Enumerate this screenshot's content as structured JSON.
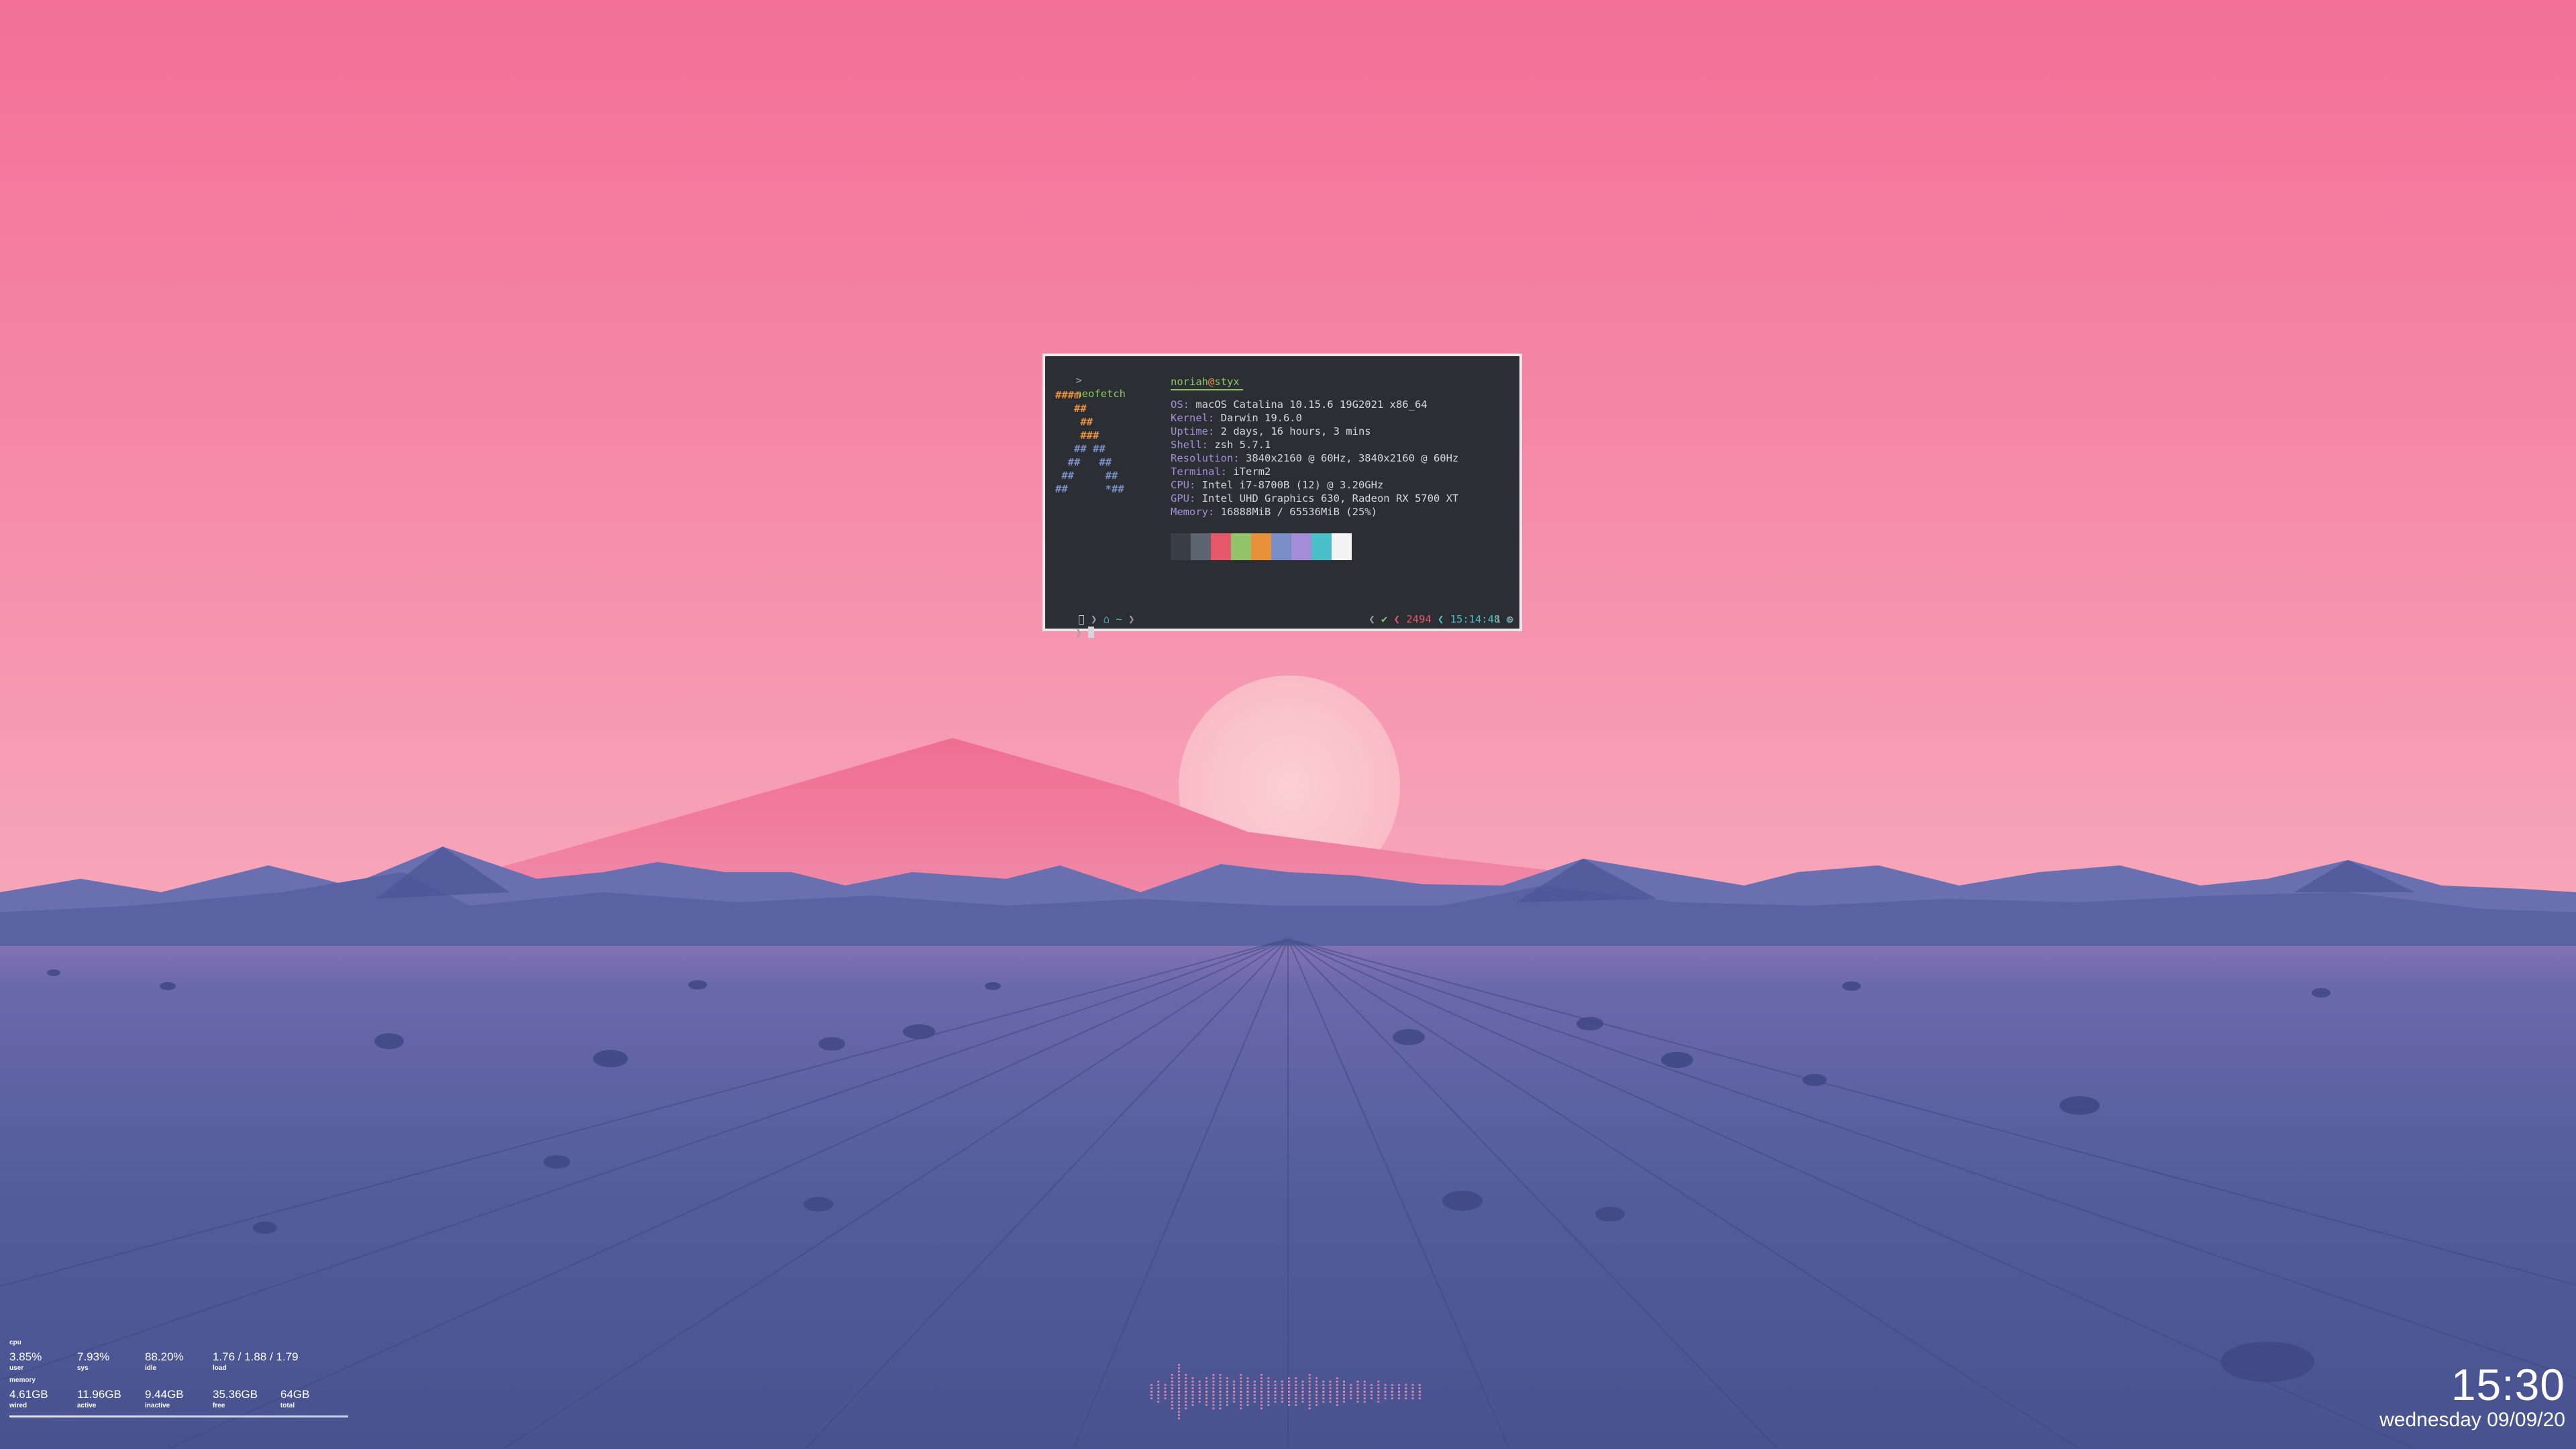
{
  "terminal": {
    "command_prompt": ">",
    "command": "neofetch",
    "user": "noriah",
    "at": "@",
    "host": "styx",
    "ascii_art": [
      "###m",
      "   ##",
      "    ##",
      "    ###",
      "   ## ##",
      "  ##   ##",
      " ##     ##",
      "##      *##"
    ],
    "info": [
      {
        "key": "OS:",
        "value": " macOS Catalina 10.15.6 19G2021 x86_64"
      },
      {
        "key": "Kernel:",
        "value": " Darwin 19.6.0"
      },
      {
        "key": "Uptime:",
        "value": " 2 days, 16 hours, 3 mins"
      },
      {
        "key": "Shell:",
        "value": " zsh 5.7.1"
      },
      {
        "key": "Resolution:",
        "value": " 3840x2160 @ 60Hz, 3840x2160 @ 60Hz"
      },
      {
        "key": "Terminal:",
        "value": " iTerm2"
      },
      {
        "key": "CPU:",
        "value": " Intel i7-8700B (12) @ 3.20GHz"
      },
      {
        "key": "GPU:",
        "value": " Intel UHD Graphics 630, Radeon RX 5700 XT"
      },
      {
        "key": "Memory:",
        "value": " 16888MiB / 65536MiB (25%)"
      }
    ],
    "palette": [
      "#3a3f47",
      "#5c6470",
      "#e8586d",
      "#93c36b",
      "#e8903a",
      "#7c8ec6",
      "#a58ed9",
      "#4ac1c9",
      "#f4f4f4"
    ],
    "prompt": {
      "apple_icon": "",
      "path": "~",
      "history_count": "2494",
      "time": "15:14:48",
      "jobs": "1",
      "check": "✔"
    }
  },
  "stats": {
    "cpu": {
      "title": "cpu",
      "values": [
        "3.85%",
        "7.93%",
        "88.20%",
        "1.76 / 1.88 / 1.79"
      ],
      "labels": [
        "user",
        "sys",
        "idle",
        "load"
      ]
    },
    "memory": {
      "title": "memory",
      "values": [
        "4.61GB",
        "11.96GB",
        "9.44GB",
        "35.36GB",
        "64GB"
      ],
      "labels": [
        "wired",
        "active",
        "inactive",
        "free",
        "total"
      ]
    }
  },
  "clock": {
    "time": "15:30",
    "date": "wednesday 09/09/20"
  },
  "visualizer": {
    "color": "#e58bb0",
    "levels": [
      0.2,
      0.3,
      0.25,
      0.5,
      0.9,
      0.6,
      0.45,
      0.35,
      0.4,
      0.55,
      0.5,
      0.4,
      0.35,
      0.6,
      0.45,
      0.3,
      0.5,
      0.4,
      0.35,
      0.3,
      0.45,
      0.4,
      0.35,
      0.5,
      0.45,
      0.3,
      0.35,
      0.4,
      0.3,
      0.25,
      0.35,
      0.3,
      0.25,
      0.3,
      0.2,
      0.25,
      0.15,
      0.2,
      0.15,
      0.1
    ]
  },
  "colors": {
    "sky_top": "#f36f97",
    "sky_horizon": "#f7a1b8",
    "ground": "#4d5795",
    "mountains": "#5e68a8",
    "sun": "#f9c3ca"
  }
}
